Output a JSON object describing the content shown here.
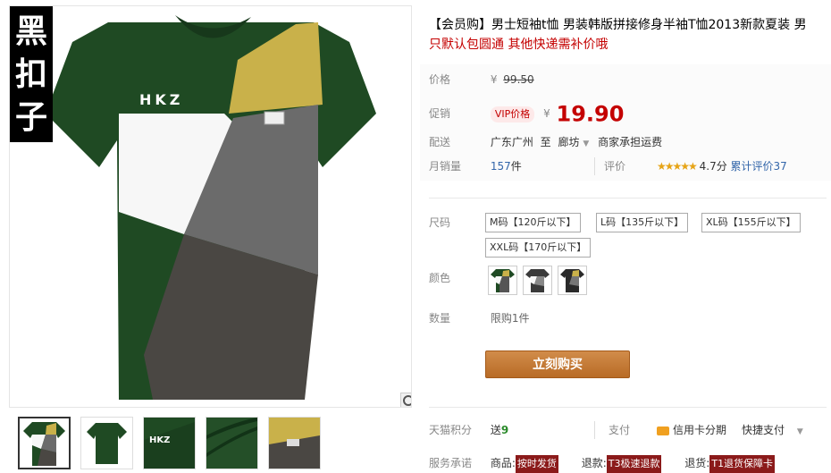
{
  "brand": "黑扣子",
  "title": {
    "text": "【会员购】男士短袖t恤 男装韩版拼接修身半袖T恤2013新款夏装 男",
    "promo": "只默认包圆通 其他快递需补价哦"
  },
  "price": {
    "label": "价格",
    "currency": "¥",
    "original": "99.50"
  },
  "promo": {
    "label": "促销",
    "vip_badge": "VIP价格",
    "currency": "¥",
    "value": "19.90"
  },
  "delivery": {
    "label": "配送",
    "from": "广东广州",
    "to_word": "至",
    "to": "廊坊",
    "note": "商家承担运费"
  },
  "sales": {
    "label": "月销量",
    "count": "157",
    "unit": "件",
    "review_label": "评价",
    "stars": "★★★★★",
    "rating": "4.7分",
    "review_count": "累计评价37"
  },
  "sizes": {
    "label": "尺码",
    "options": [
      "M码【120斤以下】",
      "L码【135斤以下】",
      "XL码【155斤以下】",
      "XXL码【170斤以下】"
    ]
  },
  "colors": {
    "label": "颜色"
  },
  "quantity": {
    "label": "数量",
    "limit": "限购1件"
  },
  "buy_button": "立刻购买",
  "points": {
    "label": "天猫积分",
    "prefix": "送",
    "value": "9",
    "pay_label": "支付",
    "installment": "信用卡分期",
    "quick_pay": "快捷支付"
  },
  "service": {
    "label": "服务承诺",
    "goods_label": "商品:",
    "goods_tag": "按时发货",
    "refund_label": "退款:",
    "refund_tag": "T3极速退款",
    "return_label": "退货:",
    "return_tag": "T1退货保障卡"
  },
  "colors_palette": {
    "price_red": "#c40000",
    "buy_orange": "#c47a35",
    "shirt_green": "#1f4a23"
  }
}
